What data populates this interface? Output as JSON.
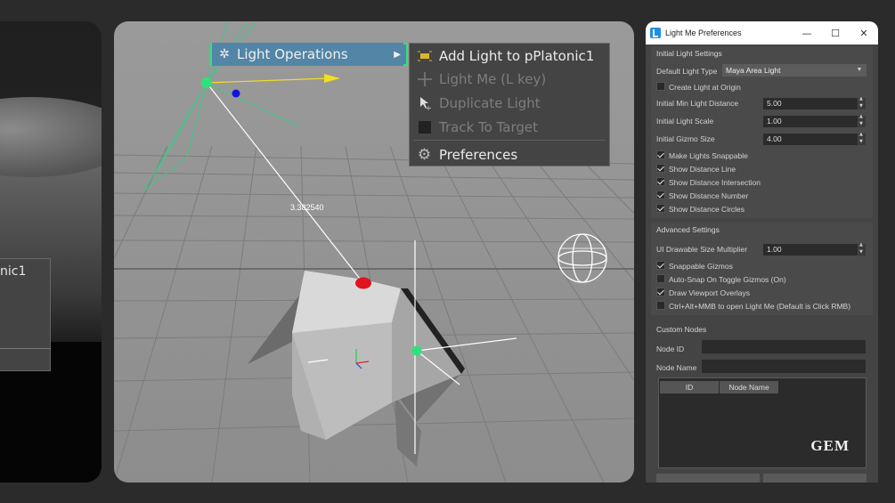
{
  "left_viewport": {
    "object_label": "nic1"
  },
  "viewport": {
    "distance_readout": "3.382540"
  },
  "menu": {
    "root_label": "Light Operations",
    "items": [
      {
        "label": "Add Light to pPlatonic1",
        "icon": "add-light-icon",
        "enabled": true
      },
      {
        "label": "Light Me (L key)",
        "icon": "crosshair-icon",
        "enabled": false
      },
      {
        "label": "Duplicate Light",
        "icon": "cursor-duplicate-icon",
        "enabled": false
      },
      {
        "label": "Track To Target",
        "icon": "square-icon",
        "enabled": false
      },
      {
        "label": "Preferences",
        "icon": "gear-icon",
        "enabled": true
      }
    ]
  },
  "prefs": {
    "title": "Light Me Preferences",
    "initial": {
      "heading": "Initial Light Settings",
      "default_light_type_label": "Default Light Type",
      "default_light_type_value": "Maya Area Light",
      "create_at_origin": {
        "label": "Create Light at Origin",
        "checked": false
      },
      "min_distance": {
        "label": "Initial Min Light Distance",
        "value": "5.00"
      },
      "scale": {
        "label": "Initial Light Scale",
        "value": "1.00"
      },
      "gizmo_size": {
        "label": "Initial Gizmo Size",
        "value": "4.00"
      },
      "checks": [
        {
          "label": "Make Lights Snappable",
          "checked": true
        },
        {
          "label": "Show Distance Line",
          "checked": true
        },
        {
          "label": "Show Distance Intersection",
          "checked": true
        },
        {
          "label": "Show Distance Number",
          "checked": true
        },
        {
          "label": "Show Distance Circles",
          "checked": true
        }
      ]
    },
    "advanced": {
      "heading": "Advanced Settings",
      "multiplier": {
        "label": "UI Drawable Size Multiplier",
        "value": "1.00"
      },
      "checks": [
        {
          "label": "Snappable Gizmos",
          "checked": true
        },
        {
          "label": "Auto-Snap On Toggle Gizmos (On)",
          "checked": false
        },
        {
          "label": "Draw Viewport Overlays",
          "checked": true
        },
        {
          "label": "Ctrl+Alt+MMB to open Light Me (Default is Click RMB)",
          "checked": false
        }
      ]
    },
    "custom": {
      "heading": "Custom Nodes",
      "node_id_label": "Node ID",
      "node_name_label": "Node Name",
      "col_id": "ID",
      "col_node_name": "Node Name",
      "logo": "GEM"
    }
  },
  "colors": {
    "menu_highlight": "#5285a6",
    "gizmo_green": "#2ee27a",
    "target_red": "#e0141e",
    "handle_blue": "#1414d8",
    "arrow_yellow": "#f0e020"
  }
}
